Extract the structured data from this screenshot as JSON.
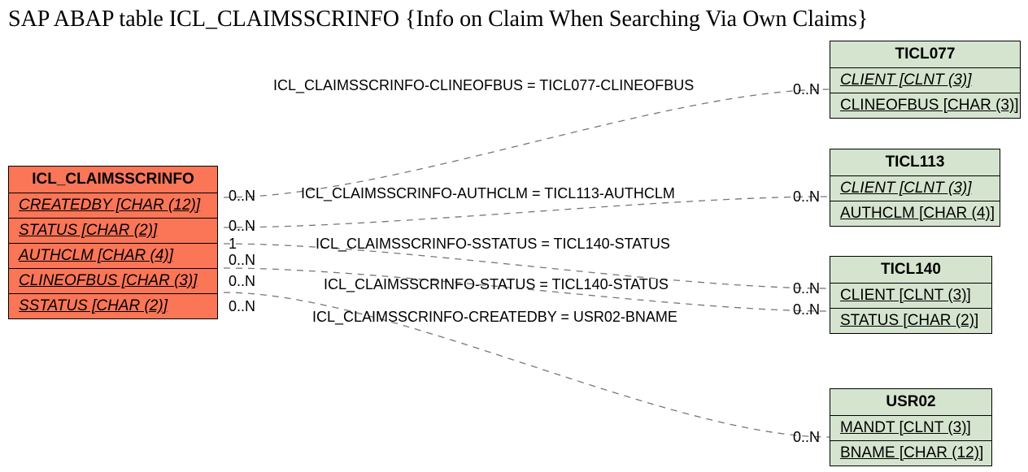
{
  "title": "SAP ABAP table ICL_CLAIMSSCRINFO {Info on Claim When Searching Via Own Claims}",
  "main": {
    "name": "ICL_CLAIMSSCRINFO",
    "fields": [
      "CREATEDBY [CHAR (12)]",
      "STATUS [CHAR (2)]",
      "AUTHCLM [CHAR (4)]",
      "CLINEOFBUS [CHAR (3)]",
      "SSTATUS [CHAR (2)]"
    ]
  },
  "targets": {
    "t1": {
      "name": "TICL077",
      "fields": [
        "CLIENT [CLNT (3)]",
        "CLINEOFBUS [CHAR (3)]"
      ]
    },
    "t2": {
      "name": "TICL113",
      "fields": [
        "CLIENT [CLNT (3)]",
        "AUTHCLM [CHAR (4)]"
      ]
    },
    "t3": {
      "name": "TICL140",
      "fields": [
        "CLIENT [CLNT (3)]",
        "STATUS [CHAR (2)]"
      ]
    },
    "t4": {
      "name": "USR02",
      "fields": [
        "MANDT [CLNT (3)]",
        "BNAME [CHAR (12)]"
      ]
    }
  },
  "rels": {
    "r1": "ICL_CLAIMSSCRINFO-CLINEOFBUS = TICL077-CLINEOFBUS",
    "r2": "ICL_CLAIMSSCRINFO-AUTHCLM = TICL113-AUTHCLM",
    "r3": "ICL_CLAIMSSCRINFO-SSTATUS = TICL140-STATUS",
    "r4": "ICL_CLAIMSSCRINFO-STATUS = TICL140-STATUS",
    "r5": "ICL_CLAIMSSCRINFO-CREATEDBY = USR02-BNAME"
  },
  "cards": {
    "cL1": "0..N",
    "cL2": "0..N",
    "cL3": "1",
    "cL4": "0..N",
    "cL5": "0..N",
    "cL6": "0..N",
    "cR1": "0..N",
    "cR2": "0..N",
    "cR3": "0..N",
    "cR4": "0..N",
    "cR5": "0..N"
  }
}
